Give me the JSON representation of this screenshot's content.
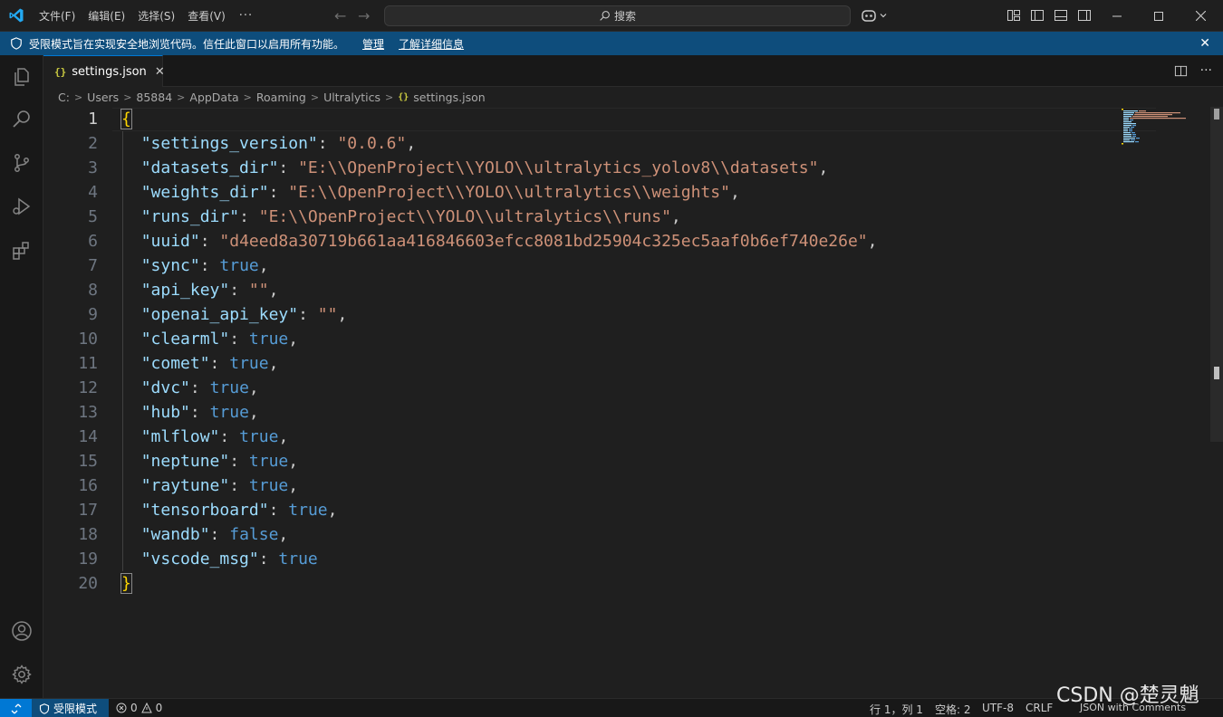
{
  "titlebar": {
    "menu": [
      "文件(F)",
      "编辑(E)",
      "选择(S)",
      "查看(V)"
    ],
    "more": "···",
    "search_label": "搜索",
    "back_icon": "arrow-left-icon",
    "forward_icon": "arrow-right-icon"
  },
  "banner": {
    "text": "受限模式旨在实现安全地浏览代码。信任此窗口以启用所有功能。",
    "manage": "管理",
    "learn_more": "了解详细信息",
    "close": "✕"
  },
  "tab": {
    "icon": "{}",
    "label": "settings.json",
    "close": "✕"
  },
  "breadcrumb": [
    "C:",
    "Users",
    "85884",
    "AppData",
    "Roaming",
    "Ultralytics"
  ],
  "breadcrumb_file": "settings.json",
  "editor": {
    "line_numbers": [
      "1",
      "2",
      "3",
      "4",
      "5",
      "6",
      "7",
      "8",
      "9",
      "10",
      "11",
      "12",
      "13",
      "14",
      "15",
      "16",
      "17",
      "18",
      "19",
      "20"
    ],
    "lines": [
      [
        {
          "t": "{",
          "c": "brace"
        }
      ],
      [
        {
          "t": "  ",
          "c": "p"
        },
        {
          "t": "\"settings_version\"",
          "c": "k"
        },
        {
          "t": ": ",
          "c": "p"
        },
        {
          "t": "\"0.0.6\"",
          "c": "s"
        },
        {
          "t": ",",
          "c": "p"
        }
      ],
      [
        {
          "t": "  ",
          "c": "p"
        },
        {
          "t": "\"datasets_dir\"",
          "c": "k"
        },
        {
          "t": ": ",
          "c": "p"
        },
        {
          "t": "\"E:\\\\OpenProject\\\\YOLO\\\\ultralytics_yolov8\\\\datasets\"",
          "c": "s"
        },
        {
          "t": ",",
          "c": "p"
        }
      ],
      [
        {
          "t": "  ",
          "c": "p"
        },
        {
          "t": "\"weights_dir\"",
          "c": "k"
        },
        {
          "t": ": ",
          "c": "p"
        },
        {
          "t": "\"E:\\\\OpenProject\\\\YOLO\\\\ultralytics\\\\weights\"",
          "c": "s"
        },
        {
          "t": ",",
          "c": "p"
        }
      ],
      [
        {
          "t": "  ",
          "c": "p"
        },
        {
          "t": "\"runs_dir\"",
          "c": "k"
        },
        {
          "t": ": ",
          "c": "p"
        },
        {
          "t": "\"E:\\\\OpenProject\\\\YOLO\\\\ultralytics\\\\runs\"",
          "c": "s"
        },
        {
          "t": ",",
          "c": "p"
        }
      ],
      [
        {
          "t": "  ",
          "c": "p"
        },
        {
          "t": "\"uuid\"",
          "c": "k"
        },
        {
          "t": ": ",
          "c": "p"
        },
        {
          "t": "\"d4eed8a30719b661aa416846603efcc8081bd25904c325ec5aaf0b6ef740e26e\"",
          "c": "s"
        },
        {
          "t": ",",
          "c": "p"
        }
      ],
      [
        {
          "t": "  ",
          "c": "p"
        },
        {
          "t": "\"sync\"",
          "c": "k"
        },
        {
          "t": ": ",
          "c": "p"
        },
        {
          "t": "true",
          "c": "b"
        },
        {
          "t": ",",
          "c": "p"
        }
      ],
      [
        {
          "t": "  ",
          "c": "p"
        },
        {
          "t": "\"api_key\"",
          "c": "k"
        },
        {
          "t": ": ",
          "c": "p"
        },
        {
          "t": "\"\"",
          "c": "s"
        },
        {
          "t": ",",
          "c": "p"
        }
      ],
      [
        {
          "t": "  ",
          "c": "p"
        },
        {
          "t": "\"openai_api_key\"",
          "c": "k"
        },
        {
          "t": ": ",
          "c": "p"
        },
        {
          "t": "\"\"",
          "c": "s"
        },
        {
          "t": ",",
          "c": "p"
        }
      ],
      [
        {
          "t": "  ",
          "c": "p"
        },
        {
          "t": "\"clearml\"",
          "c": "k"
        },
        {
          "t": ": ",
          "c": "p"
        },
        {
          "t": "true",
          "c": "b"
        },
        {
          "t": ",",
          "c": "p"
        }
      ],
      [
        {
          "t": "  ",
          "c": "p"
        },
        {
          "t": "\"comet\"",
          "c": "k"
        },
        {
          "t": ": ",
          "c": "p"
        },
        {
          "t": "true",
          "c": "b"
        },
        {
          "t": ",",
          "c": "p"
        }
      ],
      [
        {
          "t": "  ",
          "c": "p"
        },
        {
          "t": "\"dvc\"",
          "c": "k"
        },
        {
          "t": ": ",
          "c": "p"
        },
        {
          "t": "true",
          "c": "b"
        },
        {
          "t": ",",
          "c": "p"
        }
      ],
      [
        {
          "t": "  ",
          "c": "p"
        },
        {
          "t": "\"hub\"",
          "c": "k"
        },
        {
          "t": ": ",
          "c": "p"
        },
        {
          "t": "true",
          "c": "b"
        },
        {
          "t": ",",
          "c": "p"
        }
      ],
      [
        {
          "t": "  ",
          "c": "p"
        },
        {
          "t": "\"mlflow\"",
          "c": "k"
        },
        {
          "t": ": ",
          "c": "p"
        },
        {
          "t": "true",
          "c": "b"
        },
        {
          "t": ",",
          "c": "p"
        }
      ],
      [
        {
          "t": "  ",
          "c": "p"
        },
        {
          "t": "\"neptune\"",
          "c": "k"
        },
        {
          "t": ": ",
          "c": "p"
        },
        {
          "t": "true",
          "c": "b"
        },
        {
          "t": ",",
          "c": "p"
        }
      ],
      [
        {
          "t": "  ",
          "c": "p"
        },
        {
          "t": "\"raytune\"",
          "c": "k"
        },
        {
          "t": ": ",
          "c": "p"
        },
        {
          "t": "true",
          "c": "b"
        },
        {
          "t": ",",
          "c": "p"
        }
      ],
      [
        {
          "t": "  ",
          "c": "p"
        },
        {
          "t": "\"tensorboard\"",
          "c": "k"
        },
        {
          "t": ": ",
          "c": "p"
        },
        {
          "t": "true",
          "c": "b"
        },
        {
          "t": ",",
          "c": "p"
        }
      ],
      [
        {
          "t": "  ",
          "c": "p"
        },
        {
          "t": "\"wandb\"",
          "c": "k"
        },
        {
          "t": ": ",
          "c": "p"
        },
        {
          "t": "false",
          "c": "b"
        },
        {
          "t": ",",
          "c": "p"
        }
      ],
      [
        {
          "t": "  ",
          "c": "p"
        },
        {
          "t": "\"vscode_msg\"",
          "c": "k"
        },
        {
          "t": ": ",
          "c": "p"
        },
        {
          "t": "true",
          "c": "b"
        }
      ],
      [
        {
          "t": "}",
          "c": "brace"
        }
      ]
    ]
  },
  "statusbar": {
    "restricted": "受限模式",
    "errors": "0",
    "warnings": "0",
    "position": "行 1，列 1",
    "spaces": "空格: 2",
    "encoding": "UTF-8",
    "eol": "CRLF",
    "language": "JSON with Comments"
  },
  "watermark": "CSDN @楚灵魈",
  "colors": {
    "accent": "#0078d4",
    "banner": "#0e4d7c",
    "key": "#9cdcfe",
    "string": "#ce9178",
    "boolean": "#569cd6"
  }
}
